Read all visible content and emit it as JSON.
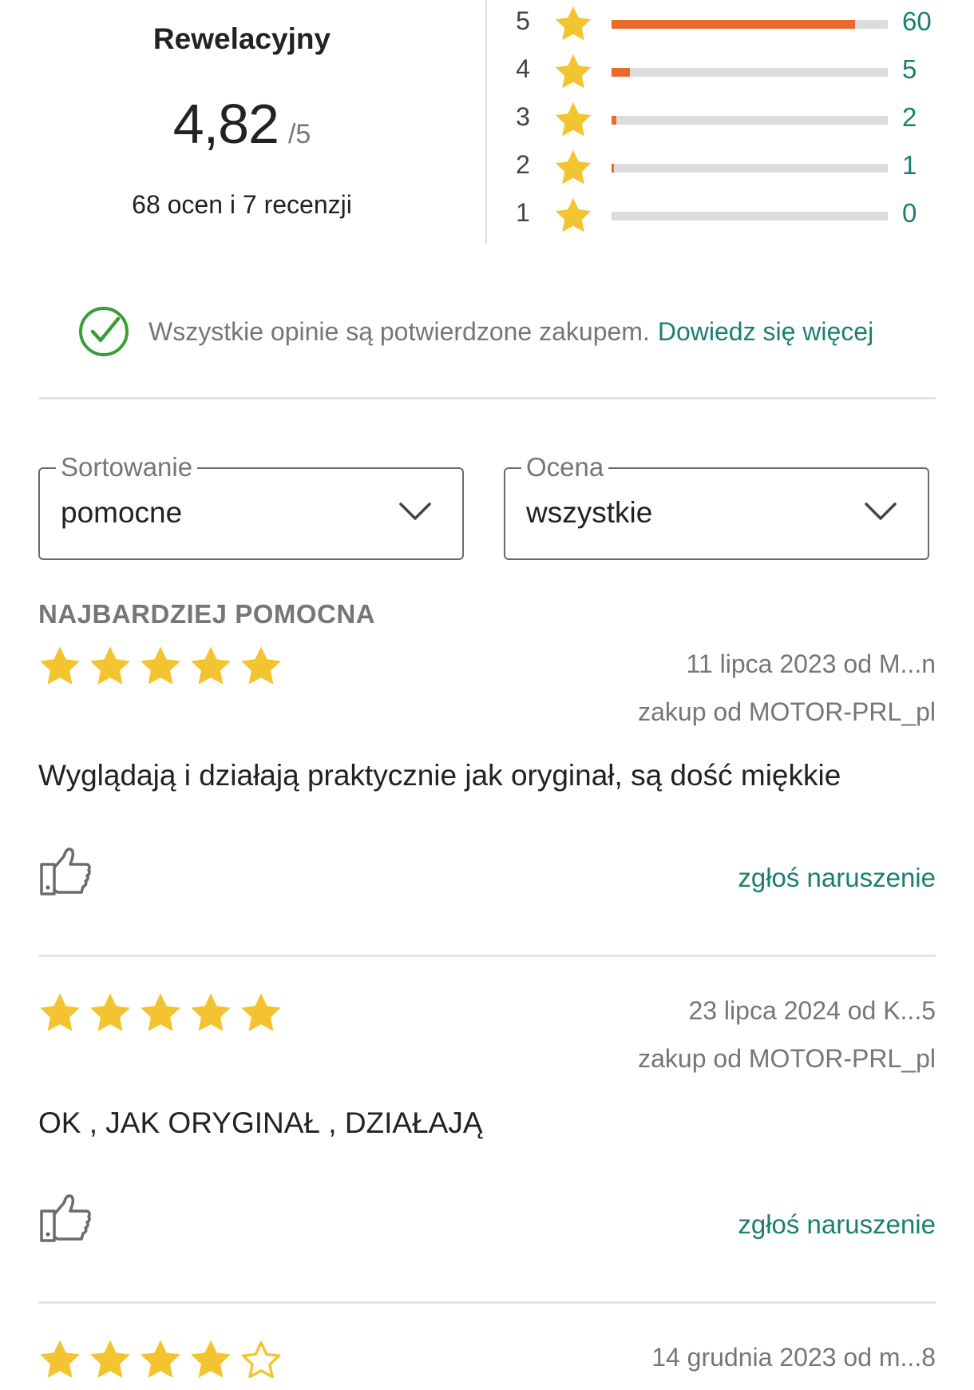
{
  "summary": {
    "label": "Rewelacyjny",
    "score": "4,82",
    "score_max": "/5",
    "count_text": "68 ocen i 7 recenzji"
  },
  "distribution": [
    {
      "stars": "5",
      "count": "60",
      "fraction": 0.882
    },
    {
      "stars": "4",
      "count": "5",
      "fraction": 0.066
    },
    {
      "stars": "3",
      "count": "2",
      "fraction": 0.018
    },
    {
      "stars": "2",
      "count": "1",
      "fraction": 0.009
    },
    {
      "stars": "1",
      "count": "0",
      "fraction": 0
    }
  ],
  "verified": {
    "text": "Wszystkie opinie są potwierdzone zakupem.",
    "link": "Dowiedz się więcej"
  },
  "filters": {
    "sort": {
      "label": "Sortowanie",
      "value": "pomocne"
    },
    "rating": {
      "label": "Ocena",
      "value": "wszystkie"
    }
  },
  "section_label": "NAJBARDZIEJ POMOCNA",
  "reviews": [
    {
      "rating": 5,
      "date": "11 lipca 2023 od M...n",
      "seller": "zakup od MOTOR-PRL_pl",
      "text": "Wyglądają i działają praktycznie jak oryginał, są dość miękkie",
      "report": "zgłoś naruszenie"
    },
    {
      "rating": 5,
      "date": "23 lipca 2024 od K...5",
      "seller": "zakup od MOTOR-PRL_pl",
      "text": "OK , JAK ORYGINAŁ , DZIAŁAJĄ",
      "report": "zgłoś naruszenie"
    },
    {
      "rating": 4,
      "date": "14 grudnia 2023 od m...8"
    }
  ],
  "colors": {
    "star": "#f4c430",
    "bar_fill": "#ea6a2d",
    "bar_track": "#dcdcdc",
    "accent": "#1a7f6f",
    "verified_check": "#3a9d3a"
  }
}
